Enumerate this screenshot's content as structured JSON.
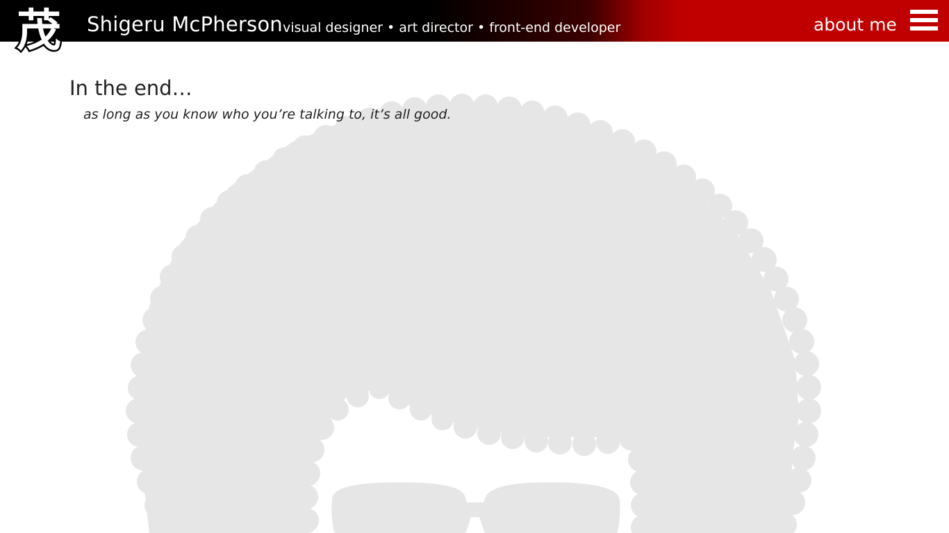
{
  "header": {
    "site_name": "Shigeru McPherson",
    "tagline": "visual designer • art director • front-end developer",
    "about_label": "about me",
    "logo_glyph": "茂",
    "logo_icon": "kanji-logo-icon",
    "menu_icon": "hamburger-menu-icon"
  },
  "main": {
    "headline": "In the end…",
    "subline": "as long as you know who you’re talking to, it’s all good."
  },
  "illustration": {
    "name": "afro-sunglasses-illustration",
    "fill_color": "#e6e6e6"
  },
  "colors": {
    "header_start": "#000000",
    "header_end": "#c00000",
    "text": "#222222",
    "header_text": "#ffffff"
  }
}
